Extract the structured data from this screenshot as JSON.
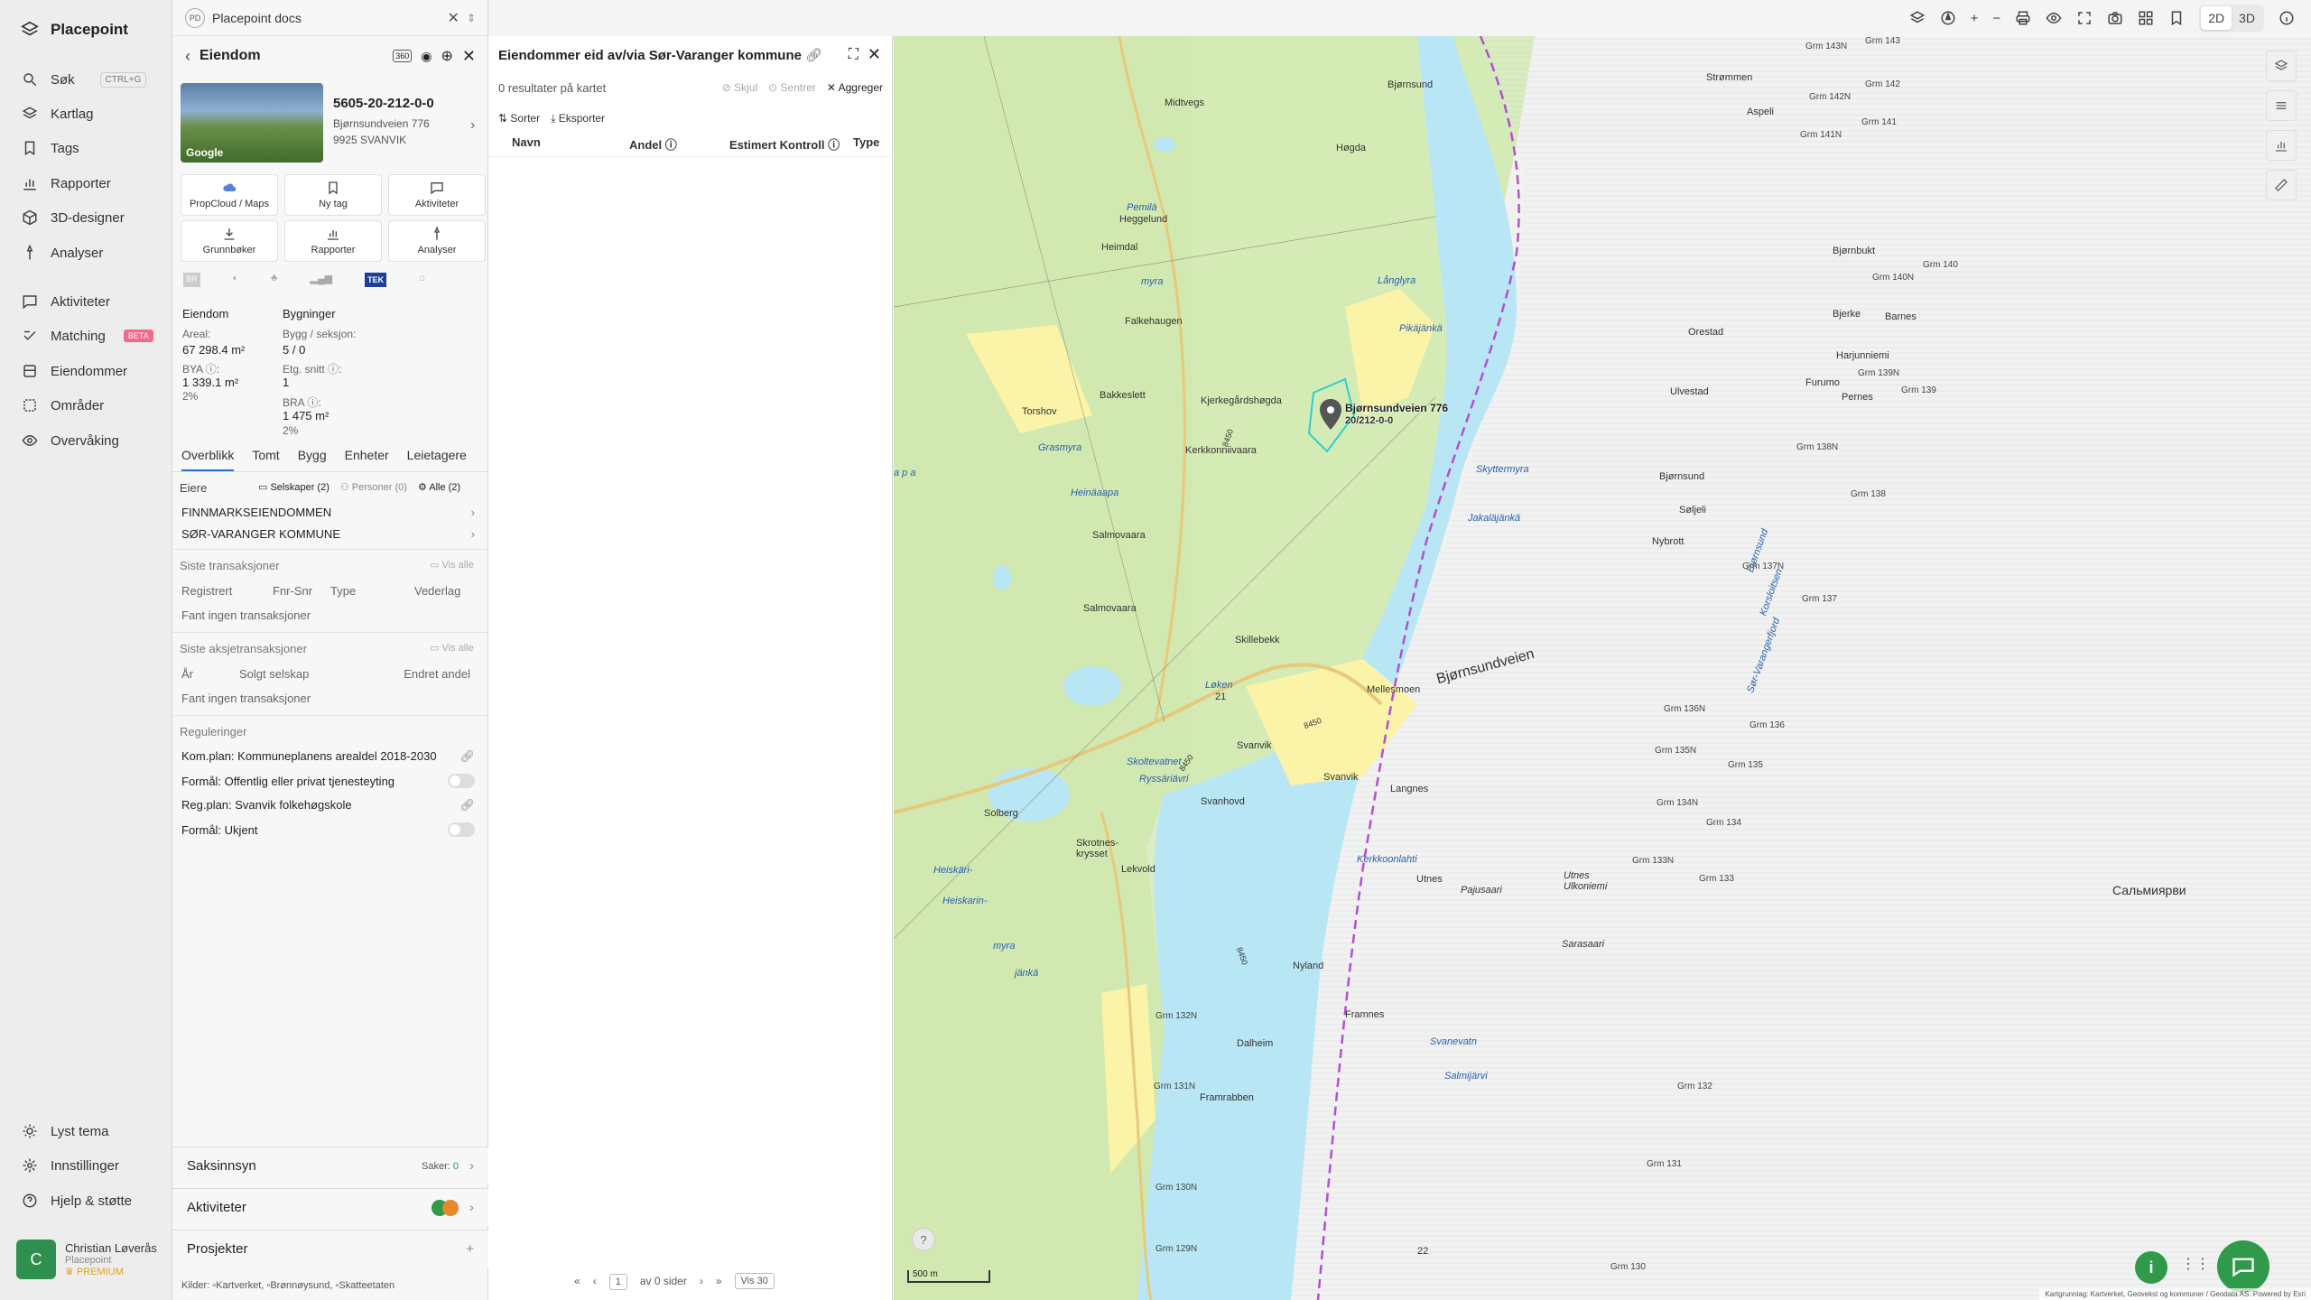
{
  "nav": {
    "brand": "Placepoint",
    "items": [
      {
        "label": "Søk",
        "icon": "search-icon",
        "shortcut": "CTRL+G"
      },
      {
        "label": "Kartlag",
        "icon": "layers-icon"
      },
      {
        "label": "Tags",
        "icon": "bookmark-icon"
      },
      {
        "label": "Rapporter",
        "icon": "bar-chart-icon"
      },
      {
        "label": "3D-designer",
        "icon": "cube-icon"
      },
      {
        "label": "Analyser",
        "icon": "pin-icon"
      },
      {
        "label": "Aktiviteter",
        "icon": "message-icon"
      },
      {
        "label": "Matching",
        "icon": "hand-icon",
        "badge": "BETA"
      },
      {
        "label": "Eiendommer",
        "icon": "home-icon"
      },
      {
        "label": "Områder",
        "icon": "area-icon"
      },
      {
        "label": "Overvåking",
        "icon": "eye-icon"
      }
    ],
    "bottom": [
      {
        "label": "Lyst tema",
        "icon": "sun-icon"
      },
      {
        "label": "Innstillinger",
        "icon": "gear-icon"
      },
      {
        "label": "Hjelp & støtte",
        "icon": "help-icon"
      }
    ],
    "user": {
      "initial": "C",
      "name": "Christian Løverås",
      "org": "Placepoint",
      "plan": "PREMIUM"
    }
  },
  "tab": {
    "badge": "PD",
    "title": "Placepoint docs"
  },
  "property": {
    "header": "Eiendom",
    "photo_label": "Google",
    "id": "5605-20-212-0-0",
    "address1": "Bjørnsundveien 776",
    "address2": "9925 SVANVIK",
    "tiles": [
      {
        "label": "PropCloud / Maps",
        "icon": "cloud-icon"
      },
      {
        "label": "Ny tag",
        "icon": "bookmark-icon"
      },
      {
        "label": "Aktiviteter",
        "icon": "message-icon"
      },
      {
        "label": "Grunnbøker",
        "icon": "download-icon"
      },
      {
        "label": "Rapporter",
        "icon": "bar-chart-icon"
      },
      {
        "label": "Analyser",
        "icon": "pin-icon"
      }
    ],
    "sources_row": [
      "BR",
      "",
      "",
      "",
      "TEK",
      ""
    ],
    "eiendom_head": "Eiendom",
    "bygninger_head": "Bygninger",
    "areal_label": "Areal:",
    "areal_value": "67 298.4 m²",
    "bya_label": "BYA ⓘ:",
    "bya_value": "1 339.1 m²",
    "bya_pct": "2%",
    "bygg_label": "Bygg / seksjon:",
    "bygg_value": "5 / 0",
    "etg_label": "Etg. snitt ⓘ:",
    "etg_value": "1",
    "bra_label": "BRA ⓘ:",
    "bra_value": "1 475 m²",
    "bra_pct": "2%",
    "tabs": [
      "Overblikk",
      "Tomt",
      "Bygg",
      "Enheter",
      "Leietagere"
    ],
    "eiere_label": "Eiere",
    "filter_selskaper": "Selskaper (2)",
    "filter_personer": "Personer (0)",
    "filter_alle": "Alle (2)",
    "owners": [
      "FINNMARKSEIENDOMMEN",
      "SØR-VARANGER KOMMUNE"
    ],
    "trans_title": "Siste transaksjoner",
    "vis_alle": "Vis alle",
    "trans_cols": [
      "Registrert",
      "Fnr-Snr",
      "Type",
      "Vederlag"
    ],
    "trans_empty": "Fant ingen transaksjoner",
    "aksje_title": "Siste aksjetransaksjoner",
    "aksje_cols": [
      "År",
      "Solgt selskap",
      "Endret andel"
    ],
    "aksje_empty": "Fant ingen transaksjoner",
    "reg_title": "Reguleringer",
    "reg_items": [
      {
        "text": "Kom.plan: Kommuneplanens arealdel 2018-2030",
        "kind": "link"
      },
      {
        "text": "Formål: Offentlig eller privat tjenesteyting",
        "kind": "toggle"
      },
      {
        "text": "Reg.plan: Svanvik folkehøgskole",
        "kind": "link"
      },
      {
        "text": "Formål: Ukjent",
        "kind": "toggle"
      }
    ],
    "saksinnsyn": "Saksinnsyn",
    "saker_label": "Saker:",
    "saker_count": "0",
    "aktiviteter": "Aktiviteter",
    "prosjekter": "Prosjekter",
    "sources_label": "Kilder:",
    "sources": [
      "Kartverket,",
      "Brønnøysund,",
      "Skatteetaten"
    ]
  },
  "results": {
    "title": "Eiendommer eid av/via Sør-Varanger kommune",
    "count_text": "0 resultater på kartet",
    "skjul": "Skjul",
    "sentrer": "Sentrer",
    "aggreger": "Aggreger",
    "sorter": "Sorter",
    "eksporter": "Eksporter",
    "columns": [
      "Navn",
      "Andel ⓘ",
      "Estimert Kontroll ⓘ",
      "Type"
    ],
    "page_value": "1",
    "page_of": "av 0 sider",
    "per_page": "Vis 30"
  },
  "map": {
    "mode_2d": "2D",
    "mode_3d": "3D",
    "marker_label": "Bjørnsundveien 776",
    "marker_sub": "20/212-0-0",
    "scale": "500 m",
    "attribution": "Kartgrunnlag: Kartverket, Geovekst og kommuner / Geodata AS. Powered by Esri",
    "places": [
      "Bjørnsund",
      "Høgda",
      "Midtvegs",
      "Heggelund",
      "Heimdal",
      "Falkehaugen",
      "Torshov",
      "Bakkeslett",
      "Kjerkegårdshøgda",
      "Kerkkonniivaara",
      "Salmovaara",
      "Salmovaara",
      "Skillebekk",
      "Mellesmoen",
      "Svanvik",
      "Svanvik",
      "Svanhovd",
      "Solberg",
      "Skrotnes-krysset",
      "Lekvold",
      "Nyland",
      "Framnes",
      "Dalheim",
      "Framrabben",
      "Langnes",
      "Utnes",
      "Bjørnbukt",
      "Bjerke",
      "Barnes",
      "Harjunniemi",
      "Furumo",
      "Pernes",
      "Orestad",
      "Ulvestad",
      "Bjørnsund",
      "Søljeli",
      "Nybrott",
      "Aspeli",
      "Strømmen",
      "Sальмиярви"
    ],
    "waters": [
      "Pemilä",
      "myra",
      "Långlyra",
      "Pikäjänkä",
      "Grasmyra",
      "Heinäaapa",
      "Skyttermyra",
      "Jakaläjänkä",
      "Løken",
      "Skoltevatnet",
      "Ryssäriävri",
      "Heiskäri-",
      "Heiskarin-",
      "myra",
      "jänkä",
      "Kerkkoonlahti",
      "Pajusaari",
      "Utnes Ulkoniemi",
      "Sarasaari",
      "Svanevatn",
      "Salmijärvi",
      "Bjørnsund",
      "Korsloitsen",
      "Sør-Varangerfjord"
    ],
    "grensemerker": [
      "Grm 143",
      "Grm 142",
      "Grm 141",
      "Grm 140",
      "Grm 139",
      "Grm 138",
      "Grm 137",
      "Grm 136",
      "Grm 135",
      "Grm 134",
      "Grm 133",
      "Grm 132",
      "Grm 131",
      "Grm 130",
      "Grm 143N",
      "Grm 142N",
      "Grm 141N",
      "Grm 140N",
      "Grm 139N",
      "Grm 138N",
      "Grm 137N",
      "Grm 136N",
      "Grm 135N",
      "Grm 134N",
      "Grm 133N",
      "Grm 132N",
      "Grm 131N",
      "Grm 130N",
      "Grm 129N"
    ],
    "roads": [
      "Bjørnsundveien",
      "8450",
      "8450",
      "8450",
      "8450",
      "21",
      "22"
    ],
    "foreign_place": "Сальмиярви",
    "lapa": "a p a"
  }
}
